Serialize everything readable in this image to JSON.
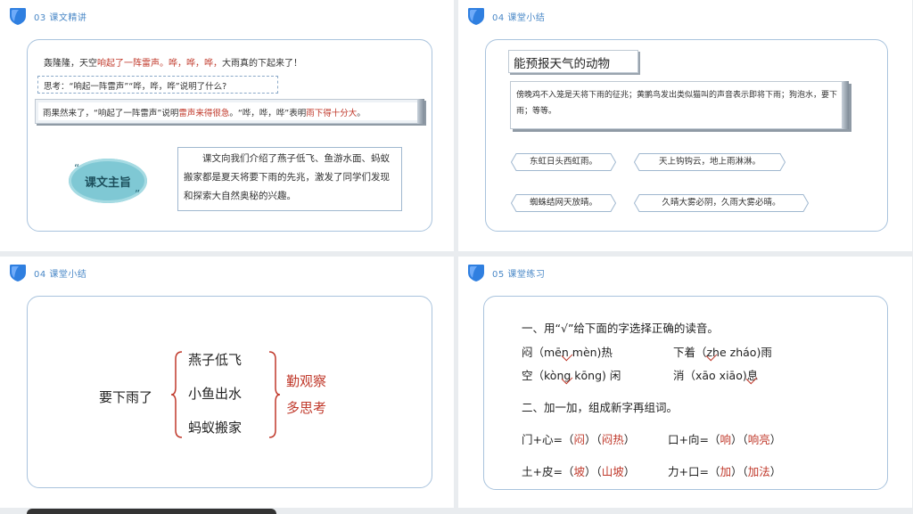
{
  "slides": {
    "s1": {
      "section": "03  课文精讲",
      "line1": {
        "a": "轰隆隆，天空",
        "b": "响起了一阵雷声。哗，哗，哗，",
        "c": "大雨真的下起来了！"
      },
      "think": "思考：“响起一阵雷声”“哗，哗，哗”说明了什么?",
      "result": {
        "a": "雨果然来了，“响起了一阵雷声”说明",
        "b": "雷声来得很急",
        "c": "。“哗，哗，哗”表明",
        "d": "雨下得十分大",
        "e": "。"
      },
      "badge": "课文主旨",
      "qmark_open": "“",
      "qmark_close": "”",
      "summary": "课文向我们介绍了燕子低飞、鱼游水面、蚂蚁搬家都是夏天将要下雨的先兆，激发了同学们发现和探索大自然奥秘的兴趣。"
    },
    "s2": {
      "section": "04  课堂小结",
      "title": "能预报天气的动物",
      "desc": "傍晚鸡不入笼是天将下雨的征兆；黄鹂鸟发出类似猫叫的声音表示即将下雨；狗泡水，要下雨；等等。",
      "sayings": [
        "东虹日头西虹雨。",
        "天上钩钩云，地上雨淋淋。",
        "蜘蛛结网天放晴。",
        "久晴大雾必阴，久雨大雾必晴。"
      ]
    },
    "s3": {
      "section": "04  课堂小结",
      "lead": "要下雨了",
      "items": [
        "燕子低飞",
        "小鱼出水",
        "蚂蚁搬家"
      ],
      "tips": [
        "勤观察",
        "多思考"
      ]
    },
    "s4": {
      "section": "05  课堂练习",
      "q1": "一、用“√”给下面的字选择正确的读音。",
      "p1": "闷（mēn   mèn)热",
      "p2": "下着（zhe   zháo)雨",
      "p3": "空（kòng   kōng) 闲",
      "p4": "消（xāo   xiāo)息",
      "q2": "二、加一加，组成新字再组词。",
      "r1": {
        "eq": "门+心=（",
        "a1": "闷",
        "mid": "）（",
        "a2": "闷热",
        "end": "）"
      },
      "r2": {
        "eq": "口+向=（",
        "a1": "响",
        "mid": "）（",
        "a2": "响亮",
        "end": "）"
      },
      "r3": {
        "eq": "土+皮=（",
        "a1": "坡",
        "mid": "）（",
        "a2": "山坡",
        "end": "）"
      },
      "r4": {
        "eq": "力+口=（",
        "a1": "加",
        "mid": "）（",
        "a2": "加法",
        "end": "）"
      }
    }
  },
  "colors": {
    "accent": "#4a88c7",
    "answer": "#c0392b",
    "frame": "#a9c3dd"
  },
  "icons": {
    "logo": "shield-logo-icon"
  }
}
